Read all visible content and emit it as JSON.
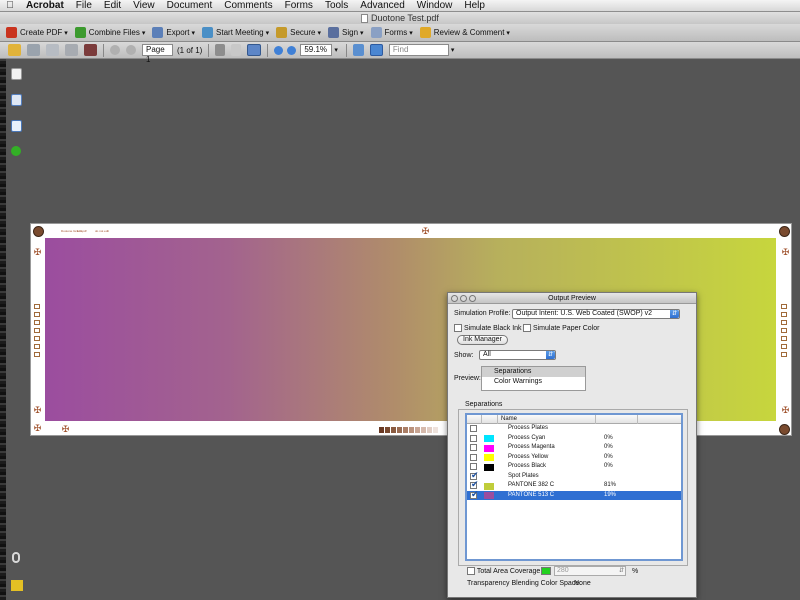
{
  "menubar": {
    "app": "Acrobat",
    "items": [
      "File",
      "Edit",
      "View",
      "Document",
      "Comments",
      "Forms",
      "Tools",
      "Advanced",
      "Window",
      "Help"
    ]
  },
  "window": {
    "title": "Duotone Test.pdf"
  },
  "toolbar1": {
    "create_pdf": "Create PDF",
    "combine_files": "Combine Files",
    "export": "Export",
    "start_meeting": "Start Meeting",
    "secure": "Secure",
    "sign": "Sign",
    "forms": "Forms",
    "review_comment": "Review & Comment"
  },
  "toolbar2": {
    "page_value": "Page 1",
    "page_count": "(1 of 1)",
    "zoom_value": "59.1%",
    "find_placeholder": "Find"
  },
  "dialog": {
    "title": "Output Preview",
    "simulation_profile_label": "Simulation Profile:",
    "simulation_profile_value": "Output Intent: U.S. Web Coated (SWOP) v2",
    "simulate_black_ink": "Simulate Black Ink",
    "simulate_paper_color": "Simulate Paper Color",
    "ink_manager": "Ink Manager",
    "show_label": "Show:",
    "show_value": "All",
    "preview_label": "Preview:",
    "preview_options": [
      "Separations",
      "Color Warnings"
    ],
    "separations_group": "Separations",
    "table_header_name": "Name",
    "separations": [
      {
        "name": "Process Plates",
        "value": "",
        "color": "",
        "checked": false
      },
      {
        "name": "Process Cyan",
        "value": "0%",
        "color": "#00e5ff",
        "checked": false
      },
      {
        "name": "Process Magenta",
        "value": "0%",
        "color": "#ff00ff",
        "checked": false
      },
      {
        "name": "Process Yellow",
        "value": "0%",
        "color": "#ffff00",
        "checked": false
      },
      {
        "name": "Process Black",
        "value": "0%",
        "color": "#000000",
        "checked": false
      },
      {
        "name": "Spot Plates",
        "value": "",
        "color": "",
        "checked": true
      },
      {
        "name": "PANTONE 382 C",
        "value": "81%",
        "color": "#c0cd3a",
        "checked": true
      },
      {
        "name": "PANTONE 513 C",
        "value": "19%",
        "color": "#9b4d9f",
        "checked": true,
        "selected": true
      }
    ],
    "total_area_coverage": "Total Area Coverage",
    "coverage_value": "280",
    "coverage_unit": "%",
    "transparency_label": "Transparency Blending Color Space:",
    "transparency_value": "None"
  },
  "page": {
    "header_texts": [
      "Duotone Grad 1",
      "1-1-pdf",
      "do not edit"
    ]
  },
  "colors": {
    "gradient_start": "#9b4d9f",
    "gradient_end": "#c7d63d",
    "selection": "#2f6fd2",
    "coverage_swatch": "#22d11f"
  }
}
